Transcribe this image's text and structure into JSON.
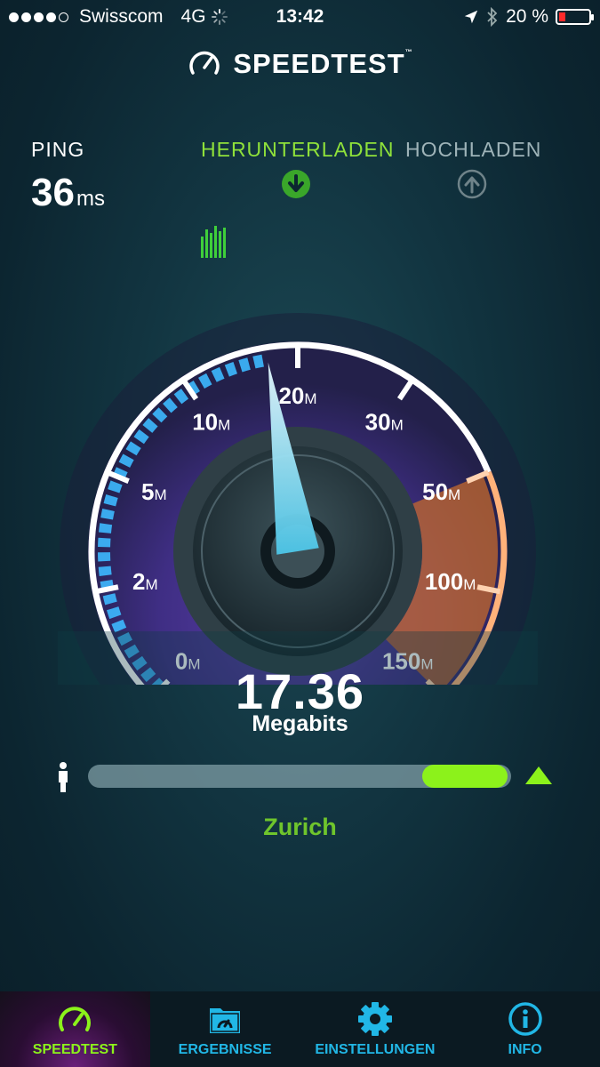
{
  "status_bar": {
    "carrier": "Swisscom",
    "network": "4G",
    "time": "13:42",
    "battery": "20 %",
    "signal_bars_filled": 4,
    "signal_bars_total": 5
  },
  "app": {
    "title": "SPEEDTEST",
    "trademark": "™"
  },
  "metrics": {
    "ping_label": "PING",
    "ping_value": "36",
    "ping_unit": "ms",
    "download_label": "HERUNTERLADEN",
    "upload_label": "HOCHLADEN"
  },
  "gauge": {
    "labels": [
      "0",
      "2",
      "5",
      "10",
      "20",
      "30",
      "50",
      "100",
      "150"
    ],
    "unit_suffix": "M",
    "current_value": 17.36
  },
  "result": {
    "value": "17.36",
    "unit": "Megabits"
  },
  "server": {
    "location": "Zurich",
    "progress": 0.79
  },
  "colors": {
    "accent_green": "#8cf21b",
    "accent_blue": "#21b7e6",
    "orange": "#f08a3a",
    "purple": "#7b5bd6"
  },
  "tabs": [
    {
      "label": "SPEEDTEST",
      "icon": "speedometer-icon",
      "active": true
    },
    {
      "label": "ERGEBNISSE",
      "icon": "results-folder-icon",
      "active": false
    },
    {
      "label": "EINSTELLUNGEN",
      "icon": "gear-icon",
      "active": false
    },
    {
      "label": "INFO",
      "icon": "info-icon",
      "active": false
    }
  ]
}
